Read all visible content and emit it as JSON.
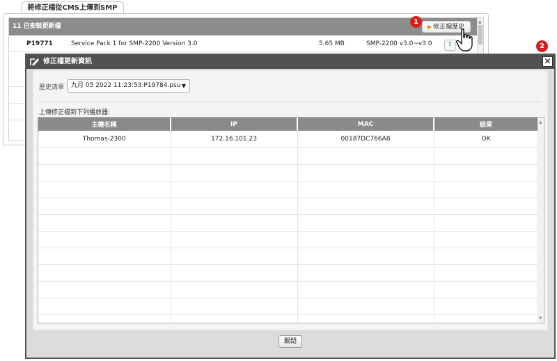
{
  "background": {
    "tab_title": "將修正檔從CMS上傳到SMP",
    "header": "11 已安裝更新檔",
    "row": {
      "id": "P19771",
      "description": "Service Pack 1 for SMP-2200 Version 3.0",
      "size": "5.65 MB",
      "compatibility": "SMP-2200 v3.0~v3.0"
    },
    "history_button": "修正檔歷史",
    "upload_icon": "upload-icon"
  },
  "callouts": [
    "1",
    "2"
  ],
  "dialog": {
    "title": "修正檔更新資訊",
    "close_icon": "close-icon",
    "history_label": "歷史清單",
    "history_selected": "九月 05 2022 11:23:53:P19784.psu",
    "upload_label": "上傳修正檔到下列播放器:",
    "columns": [
      "主機名稱",
      "IP",
      "MAC",
      "結果"
    ],
    "rows": [
      [
        "Thomas-2300",
        "172.16.101.23",
        "00187DC766A8",
        "OK"
      ]
    ],
    "close_button": "關閉"
  },
  "colors": {
    "header_gray": "#8c8c8c",
    "dialog_title": "#515151",
    "badge_red": "#d7201e"
  }
}
